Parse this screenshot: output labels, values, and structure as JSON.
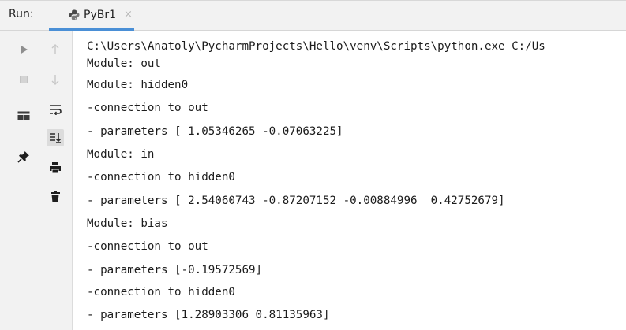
{
  "header": {
    "run_label": "Run:",
    "tab_label": "PyBr1",
    "tab_close": "×",
    "tab_icon": "python-icon"
  },
  "toolbar": {
    "col1": [
      "rerun-icon",
      "stop-icon",
      "layout-icon",
      "pin-icon"
    ],
    "col2": [
      "up-arrow-icon",
      "down-arrow-icon",
      "soft-wrap-icon",
      "scroll-to-end-icon",
      "print-icon",
      "trash-icon"
    ]
  },
  "console": {
    "lines": [
      "C:\\Users\\Anatoly\\PycharmProjects\\Hello\\venv\\Scripts\\python.exe C:/Us",
      "Module: out",
      "Module: hidden0",
      "-connection to out",
      "- parameters [ 1.05346265 -0.07063225]",
      "Module: in",
      "-connection to hidden0",
      "- parameters [ 2.54060743 -0.87207152 -0.00884996  0.42752679]",
      "Module: bias",
      "-connection to out",
      "- parameters [-0.19572569]",
      "-connection to hidden0",
      "- parameters [1.28903306 0.81135963]"
    ]
  },
  "colors": {
    "accent": "#4a8fd6",
    "panel": "#f2f2f2",
    "text": "#1c1c1c"
  }
}
